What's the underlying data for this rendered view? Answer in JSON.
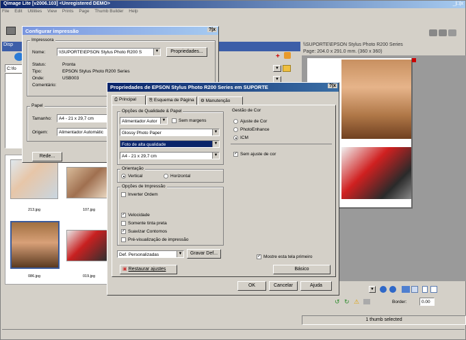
{
  "app": {
    "title": "Qimage Lite [v2006.103] <Unregistered DEMO>",
    "menu": [
      "File",
      "Edit",
      "Utilities",
      "View",
      "Prints",
      "Page",
      "Thumb Builder",
      "Help"
    ],
    "window_controls": "_|□|x"
  },
  "left_panel": {
    "tab_label": "Disp",
    "path_value": "C:\\fo"
  },
  "thumbs": [
    {
      "label": "213.jpg"
    },
    {
      "label": "107.jpg"
    },
    {
      "label": "086.jpg"
    },
    {
      "label": "019.jpg"
    }
  ],
  "preview": {
    "title": "\\\\SUPORTE\\EPSON Stylus Photo R200 Series",
    "page_info": "Page: 204.0 x 291.0 mm.  (360 x 360)"
  },
  "bottom_right": {
    "border_label": "Border:",
    "border_value": "0.00",
    "status": "1 thumb selected"
  },
  "print_setup": {
    "title": "Configurar impressão",
    "help_close": "?|x",
    "printer_group": "Impressora",
    "name_label": "Nome:",
    "name_value": "\\\\SUPORTE\\EPSON Stylus Photo R200 S",
    "properties_button": "Propriedades...",
    "status_label": "Status:",
    "status_value": "Pronta",
    "type_label": "Tipo:",
    "type_value": "EPSON Stylus Photo R200 Series",
    "where_label": "Onde:",
    "where_value": "USB003",
    "comment_label": "Comentário:",
    "paper_group": "Papel",
    "size_label": "Tamanho:",
    "size_value": "A4 - 21 x 29,7 cm",
    "source_label": "Origem:",
    "source_value": "Alimentador Automátic",
    "network_button": "Rede..."
  },
  "properties": {
    "title": "Propriedades de EPSON Stylus Photo R200 Series em SUPORTE",
    "help_close": "?|x",
    "tabs": [
      "Principal",
      "Esquema de Página",
      "Manutenção"
    ],
    "quality_group": "Opções de Qualidade & Papel",
    "feeder_value": "Alimentador Autor",
    "no_margin_label": "Sem margens",
    "paper_type_value": "Glossy Photo Paper",
    "quality_value": "Foto de alta qualidade",
    "paper_size_value": "A4 - 21 x 29,7 cm",
    "orientation_group": "Orientação",
    "vertical_label": "Vertical",
    "horizontal_label": "Horizontal",
    "print_options_group": "Opções de Impressão",
    "invert_order_label": "Inverter Ordem",
    "speed_label": "Velocidade",
    "black_only_label": "Somente tinta preta",
    "smooth_label": "Suavizar Contornos",
    "preview_label": "Pré-visualização de impressão",
    "custom_value": "Def. Personalizadas",
    "save_def_button": "Gravar Def...",
    "restore_button": "Restaurar ajustes",
    "color_group": "Gestão de Cor",
    "color_adjust_label": "Ajuste de Cor",
    "photo_enhance_label": "PhotoEnhance",
    "icm_label": "ICM",
    "no_color_adjust_label": "Sem ajuste de cor",
    "show_first_label": "Mostre esta tela primeiro",
    "basic_button": "Básico",
    "ok_button": "OK",
    "cancel_button": "Cancelar",
    "help_button": "Ajuda"
  }
}
